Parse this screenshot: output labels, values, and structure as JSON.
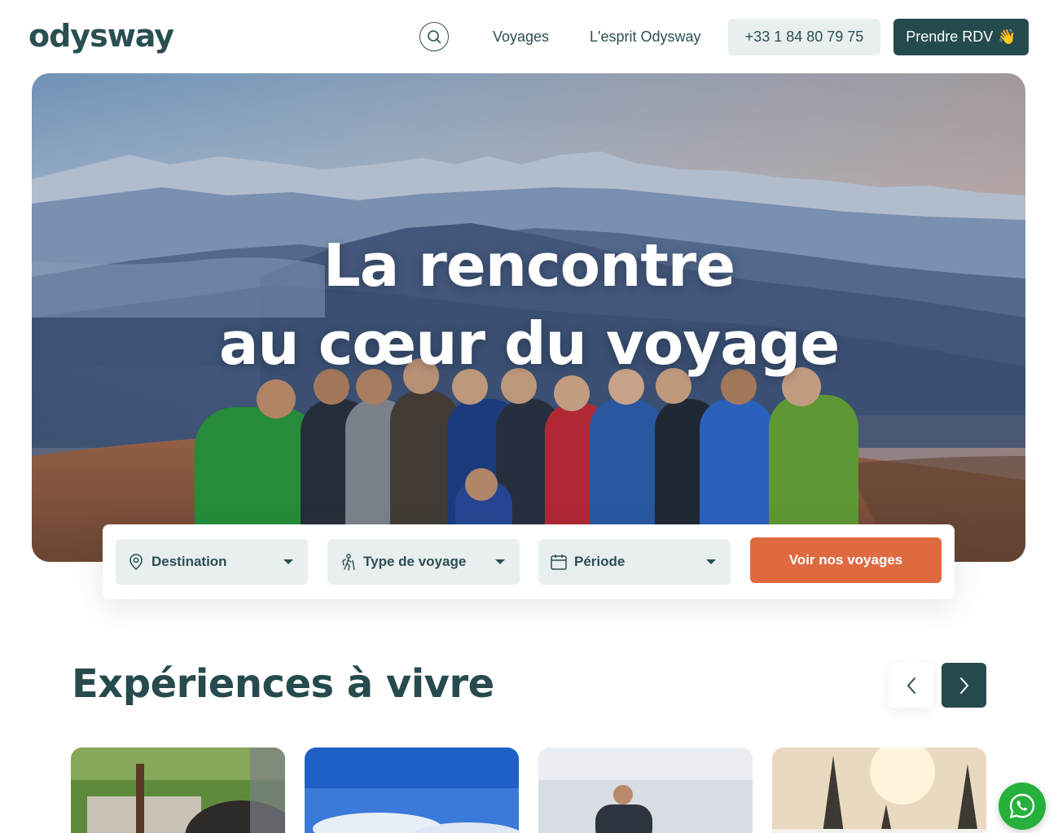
{
  "header": {
    "logo": "odysway",
    "nav": [
      {
        "label": "Voyages"
      },
      {
        "label": "L'esprit Odysway"
      }
    ],
    "phone": "+33 1 84 80 79 75",
    "rdv_label": "Prendre RDV",
    "rdv_emoji": "👋"
  },
  "hero": {
    "title_line1": "La rencontre",
    "title_line2": "au cœur du voyage"
  },
  "search": {
    "destination": "Destination",
    "type": "Type de voyage",
    "periode": "Période",
    "cta": "Voir nos voyages"
  },
  "section": {
    "title": "Expériences à vivre"
  },
  "colors": {
    "brand": "#254a4d",
    "accent": "#e06a3f",
    "chip_bg": "#e9eeee",
    "whatsapp": "#25b13b"
  }
}
